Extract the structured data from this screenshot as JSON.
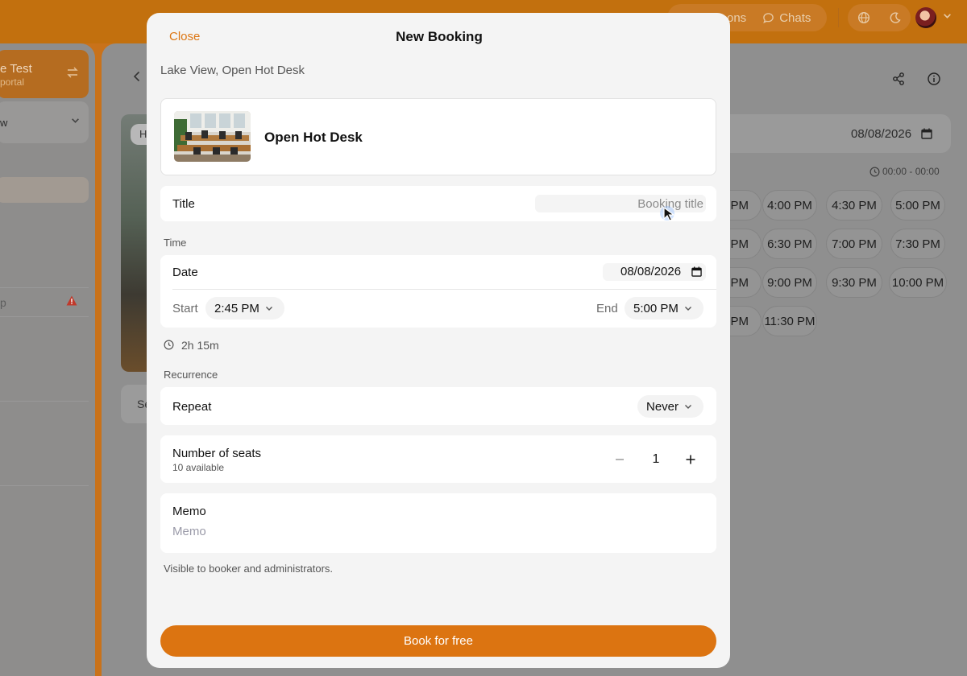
{
  "background": {
    "topbar": {
      "chats_partial": "ons",
      "chats_label": "Chats"
    },
    "left_panel": {
      "org_title_partial": "e Test",
      "org_sub_partial": "portal",
      "select_partial": "w",
      "warn_partial": "p"
    },
    "main": {
      "image_tag_partial": "H",
      "tab_partial": "Se",
      "date_value": "08/08/2026",
      "hours": "00:00 - 00:00",
      "slots": [
        "PM",
        "4:00 PM",
        "4:30 PM",
        "5:00 PM",
        "PM",
        "6:30 PM",
        "7:00 PM",
        "7:30 PM",
        "PM",
        "9:00 PM",
        "9:30 PM",
        "10:00 PM",
        "PM",
        "11:30 PM"
      ]
    }
  },
  "modal": {
    "close_label": "Close",
    "title": "New Booking",
    "location": "Lake View, Open Hot Desk",
    "resource": {
      "name": "Open Hot Desk"
    },
    "title_field": {
      "label": "Title",
      "placeholder": "Booking title"
    },
    "time": {
      "section_label": "Time",
      "date_label": "Date",
      "date_value": "08/08/2026",
      "start_label": "Start",
      "start_value": "2:45 PM",
      "end_label": "End",
      "end_value": "5:00 PM",
      "duration": "2h 15m"
    },
    "recurrence": {
      "section_label": "Recurrence",
      "repeat_label": "Repeat",
      "repeat_value": "Never"
    },
    "seats": {
      "label": "Number of seats",
      "available": "10 available",
      "value": "1"
    },
    "memo": {
      "label": "Memo",
      "placeholder": "Memo",
      "hint": "Visible to booker and administrators."
    },
    "submit_label": "Book for free"
  },
  "colors": {
    "accent": "#dc7411",
    "overlay_dim": "#8f8f8f"
  }
}
